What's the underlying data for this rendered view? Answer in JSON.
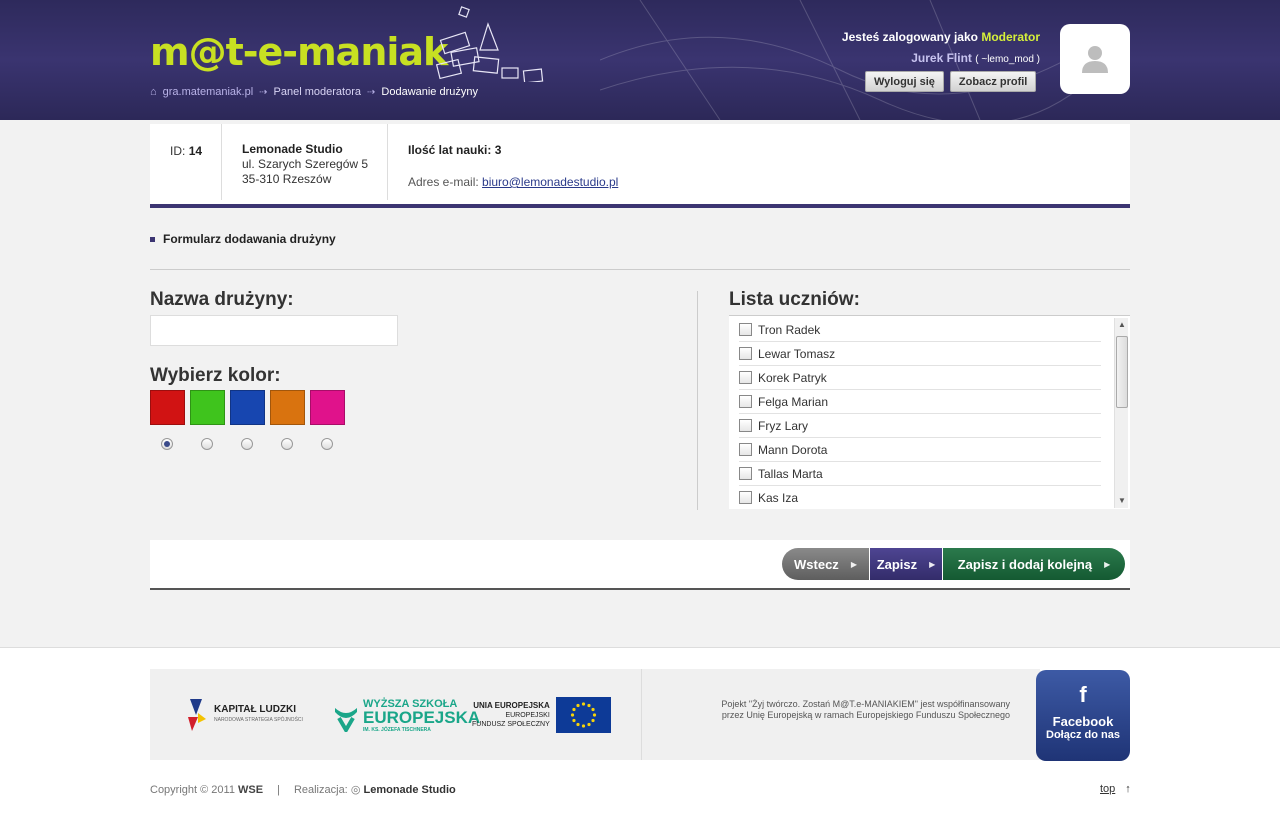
{
  "header": {
    "logo_text": "m@t-e-maniak",
    "breadcrumb": [
      "gra.matemaniak.pl",
      "Panel moderatora",
      "Dodawanie drużyny"
    ],
    "user": {
      "logged_as_prefix": "Jesteś zalogowany jako",
      "role": "Moderator",
      "name": "Jurek Flint",
      "nick": "( ~lemo_mod )"
    },
    "buttons": {
      "logout": "Wyloguj się",
      "profile": "Zobacz profil"
    }
  },
  "info": {
    "id_label": "ID:",
    "id_value": "14",
    "company_name": "Lemonade Studio",
    "street": "ul. Szarych Szeregów 5",
    "city": "35-310 Rzeszów",
    "years_label": "Ilość lat nauki: 3",
    "email_label": "Adres e-mail:",
    "email": "biuro@lemonadestudio.pl"
  },
  "section_title": "Formularz dodawania drużyny",
  "form": {
    "team_name_label": "Nazwa drużyny:",
    "team_name_value": "",
    "color_label": "Wybierz kolor:",
    "colors": [
      "#d11313",
      "#3fc41d",
      "#1746b0",
      "#d9730f",
      "#e0128b"
    ],
    "selected_color_index": 0,
    "students_label": "Lista uczniów:",
    "students": [
      "Tron Radek",
      "Lewar Tomasz",
      "Korek Patryk",
      "Felga Marian",
      "Fryz Lary",
      "Mann Dorota",
      "Tallas Marta",
      "Kas Iza"
    ]
  },
  "actions": {
    "back": "Wstecz",
    "save": "Zapisz",
    "save_add": "Zapisz i dodaj kolejną"
  },
  "footer": {
    "kl_title": "KAPITAŁ LUDZKI",
    "kl_sub": "NARODOWA STRATEGIA SPÓJNOŚCI",
    "wse_line1": "WYŻSZA SZKOŁA",
    "wse_line2": "EUROPEJSKA",
    "wse_line3": "IM. KS. JÓZEFA TISCHNERA",
    "eu_title": "UNIA EUROPEJSKA",
    "eu_line1": "EUROPEJSKI",
    "eu_line2": "FUNDUSZ SPOŁECZNY",
    "note_line1": "Pojekt \"Żyj twórczo. Zostań M@T.e-MANIAKIEM\" jest współfinansowany",
    "note_line2": "przez Unię Europejską w ramach Europejskiego Funduszu Społecznego",
    "fb_title": "Facebook",
    "fb_sub": "Dołącz do nas",
    "copyright_prefix": "Copyright © 2011",
    "copyright_org": "WSE",
    "separator": "|",
    "realization_label": "Realizacja:",
    "realization_name": "Lemonade Studio",
    "top_link": "top",
    "top_arrow": "↑"
  }
}
